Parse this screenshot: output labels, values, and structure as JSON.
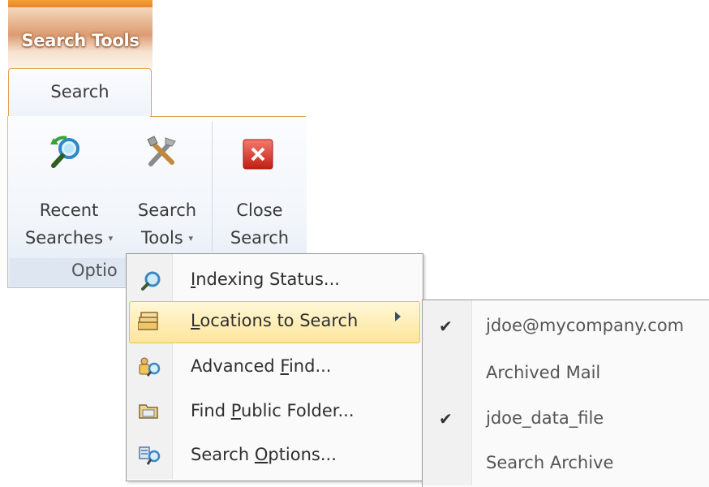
{
  "contextual_tab": {
    "title": "Search Tools"
  },
  "tab": {
    "label": "Search"
  },
  "ribbon": {
    "buttons": [
      {
        "line1": "Recent",
        "line2": "Searches",
        "icon": "magnifier-refresh-icon",
        "has_dropdown": true
      },
      {
        "line1": "Search",
        "line2": "Tools",
        "icon": "tools-icon",
        "has_dropdown": true
      },
      {
        "line1": "Close",
        "line2": "Search",
        "icon": "close-red-x-icon",
        "has_dropdown": false
      }
    ],
    "group_label": "Optio",
    "dropdown_glyph": "▾"
  },
  "menu": {
    "items": [
      {
        "label": "Indexing Status...",
        "underline": "I",
        "icon": "indexing-icon"
      },
      {
        "label": "Locations to Search",
        "underline": "L",
        "icon": "folder-stack-icon",
        "highlighted": true,
        "has_submenu": true
      },
      {
        "label": "Advanced Find...",
        "underline": "F",
        "icon": "advanced-find-icon"
      },
      {
        "label": "Find Public Folder...",
        "underline": "P",
        "icon": "public-folder-icon"
      },
      {
        "label": "Search Options...",
        "underline": "O",
        "icon": "search-options-icon"
      }
    ]
  },
  "submenu": {
    "items": [
      {
        "label": "jdoe@mycompany.com",
        "checked": true
      },
      {
        "label": "Archived Mail",
        "checked": false
      },
      {
        "label": "jdoe_data_file",
        "checked": true
      },
      {
        "label": "Search Archive",
        "checked": false
      }
    ],
    "check_glyph": "✔"
  }
}
